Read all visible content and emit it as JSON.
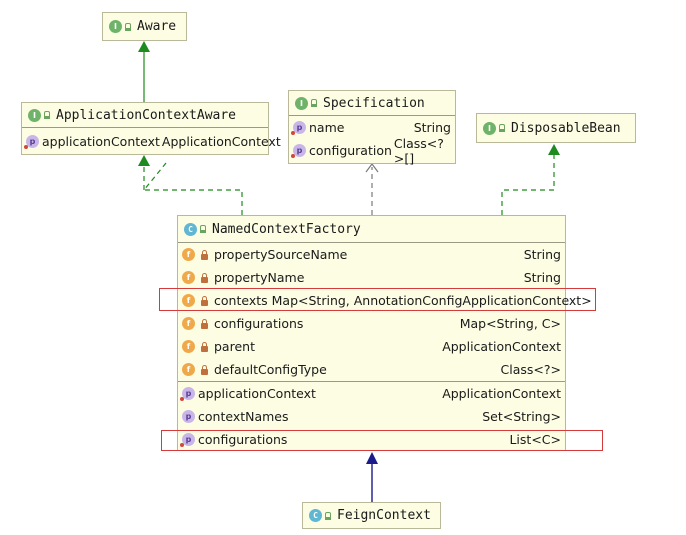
{
  "aware": {
    "badge": "I",
    "name": "Aware"
  },
  "application_context_aware": {
    "badge": "I",
    "name": "ApplicationContextAware",
    "members": [
      {
        "badge": "p",
        "name": "applicationContext",
        "type": "ApplicationContext"
      }
    ]
  },
  "specification": {
    "badge": "I",
    "name": "Specification",
    "members": [
      {
        "badge": "p",
        "name": "name",
        "type": "String"
      },
      {
        "badge": "p",
        "name": "configuration",
        "type": "Class<?>[]"
      }
    ]
  },
  "disposable_bean": {
    "badge": "I",
    "name": "DisposableBean"
  },
  "named_context_factory": {
    "badge": "C",
    "name": "NamedContextFactory",
    "fields": [
      {
        "badge": "f",
        "name": "propertySourceName",
        "type": "String"
      },
      {
        "badge": "f",
        "name": "propertyName",
        "type": "String"
      },
      {
        "badge": "f",
        "name": "contexts",
        "type": "Map<String, AnnotationConfigApplicationContext>"
      },
      {
        "badge": "f",
        "name": "configurations",
        "type": "Map<String, C>"
      },
      {
        "badge": "f",
        "name": "parent",
        "type": "ApplicationContext"
      },
      {
        "badge": "f",
        "name": "defaultConfigType",
        "type": "Class<?>"
      }
    ],
    "properties": [
      {
        "badge": "p",
        "name": "applicationContext",
        "type": "ApplicationContext"
      },
      {
        "badge": "p",
        "name": "contextNames",
        "type": "Set<String>"
      },
      {
        "badge": "p",
        "name": "configurations",
        "type": "List<C>"
      }
    ]
  },
  "feign_context": {
    "badge": "C",
    "name": "FeignContext"
  },
  "colors": {
    "inheritance": "#1b1b8c",
    "implements": "#1f8a1f",
    "dependency": "#7a7a7a",
    "highlight": "#d63b3b"
  }
}
